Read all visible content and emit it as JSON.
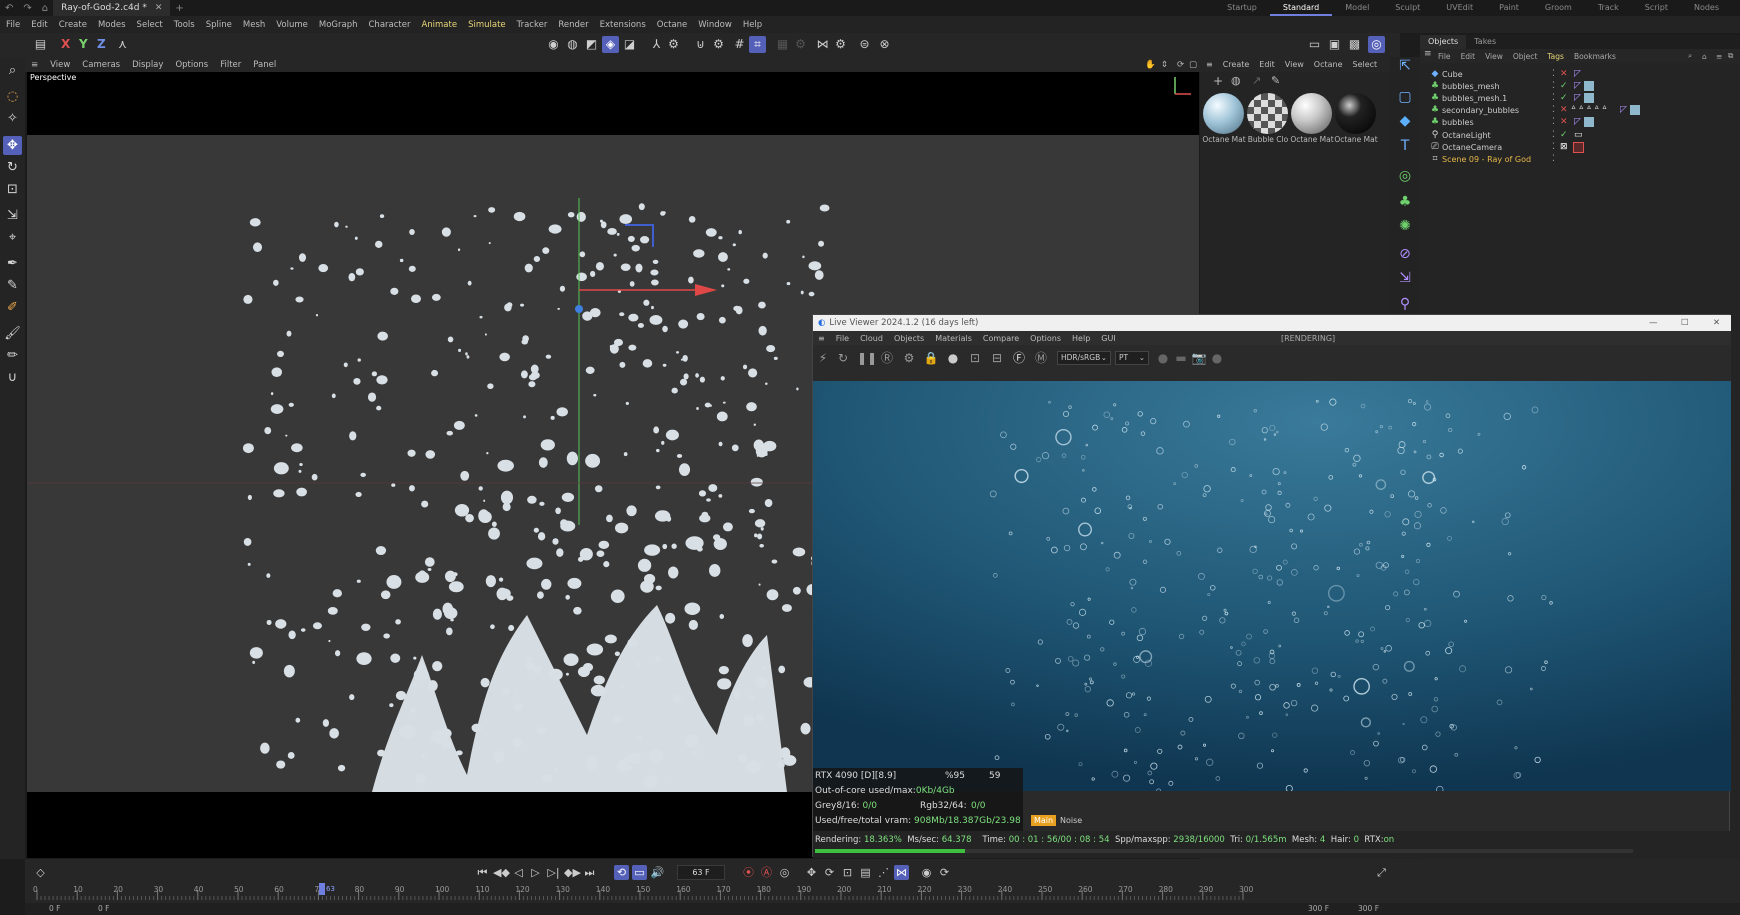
{
  "window": {
    "doc_tab": "Ray-of-God-2.c4d *",
    "layouts": [
      "Startup",
      "Standard",
      "Model",
      "Sculpt",
      "UVEdit",
      "Paint",
      "Groom",
      "Track",
      "Script",
      "Nodes"
    ],
    "active_layout": "Standard"
  },
  "menubar": [
    "File",
    "Edit",
    "Create",
    "Modes",
    "Select",
    "Tools",
    "Spline",
    "Mesh",
    "Volume",
    "MoGraph",
    "Character",
    "Animate",
    "Simulate",
    "Tracker",
    "Render",
    "Extensions",
    "Octane",
    "Window",
    "Help"
  ],
  "toolbar": {
    "axis_x": "X",
    "axis_y": "Y",
    "axis_z": "Z"
  },
  "viewport": {
    "menu": [
      "View",
      "Cameras",
      "Display",
      "Options",
      "Filter",
      "Panel"
    ],
    "label": "Perspective"
  },
  "materials": {
    "menu": [
      "Create",
      "Edit",
      "View",
      "Octane",
      "Select"
    ],
    "items": [
      "Octane Mat",
      "Bubble Clo",
      "Octane Mat",
      "Octane Mat"
    ]
  },
  "objects": {
    "tabs": [
      "Objects",
      "Takes"
    ],
    "menu": [
      "File",
      "Edit",
      "View",
      "Object",
      "Tags",
      "Bookmarks"
    ],
    "rows": [
      {
        "name": "Cube",
        "icon": "cube-icon"
      },
      {
        "name": "bubbles_mesh",
        "icon": "mesher-icon"
      },
      {
        "name": "bubbles_mesh.1",
        "icon": "mesher-icon"
      },
      {
        "name": "secondary_bubbles",
        "icon": "emitter-icon"
      },
      {
        "name": "bubbles",
        "icon": "emitter-icon"
      },
      {
        "name": "OctaneLight",
        "icon": "light-icon"
      },
      {
        "name": "OctaneCamera",
        "icon": "camera-icon"
      },
      {
        "name": "Scene 09 - Ray of God",
        "icon": "layer-icon"
      }
    ]
  },
  "live_viewer": {
    "title": "Live Viewer 2024.1.2 (16 days left)",
    "menu": [
      "File",
      "Cloud",
      "Objects",
      "Materials",
      "Compare",
      "Options",
      "Help",
      "GUI"
    ],
    "state": "[RENDERING]",
    "render_mode": "HDR/sRGB",
    "kernel": "PT",
    "stats": {
      "gpu": "RTX 4090 [D][8.9]",
      "gpu_pct": "%95",
      "gpu_temp": "59",
      "ooc_label": "Out-of-core used/max:",
      "ooc_value": "0Kb/4Gb",
      "grey_label": "Grey8/16:",
      "grey_value": "0/0",
      "rgb_label": "Rgb32/64:",
      "rgb_value": "0/0",
      "vram_label": "Used/free/total vram:",
      "vram_value": "908Mb/18.387Gb/23.98",
      "main_tab": "Main",
      "noise_tab": "Noise"
    },
    "render_line": {
      "rendering_label": "Rendering:",
      "rendering_value": "18.363%",
      "ms_label": "Ms/sec:",
      "ms_value": "64.378",
      "time_label": "Time:",
      "time_value": "00 : 01 : 56/00 : 08 : 54",
      "spp_label": "Spp/maxspp:",
      "spp_value": "2938/16000",
      "tri_label": "Tri:",
      "tri_value": "0/1.565m",
      "mesh_label": "Mesh:",
      "mesh_value": "4",
      "hair_label": "Hair:",
      "hair_value": "0",
      "rtx_label": "RTX:",
      "rtx_value": "on",
      "progress": 0.18363
    }
  },
  "timeline": {
    "current_frame": "63 F",
    "ticks": [
      "0",
      "10",
      "20",
      "30",
      "40",
      "50",
      "60",
      "70",
      "80",
      "90",
      "100",
      "110",
      "120",
      "130",
      "140",
      "150",
      "160",
      "170",
      "180",
      "190",
      "200",
      "210",
      "220",
      "230",
      "240",
      "250",
      "260",
      "270",
      "280",
      "290",
      "300"
    ],
    "playhead_label": "63",
    "start_a": "0 F",
    "start_b": "0 F",
    "end_a": "300 F",
    "end_b": "300 F"
  }
}
